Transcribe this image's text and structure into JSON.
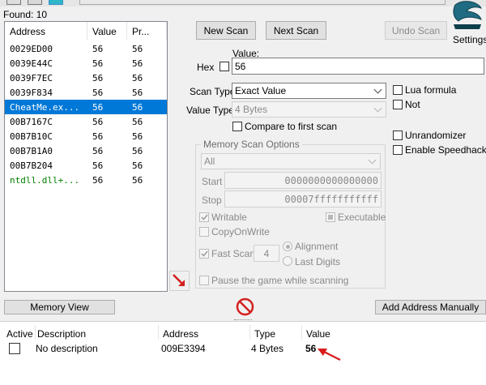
{
  "found_label": "Found: 10",
  "results": {
    "columns": [
      "Address",
      "Value",
      "Pr..."
    ],
    "rows": [
      {
        "address": "0029ED00",
        "value": "56",
        "previous": "56"
      },
      {
        "address": "0039E44C",
        "value": "56",
        "previous": "56"
      },
      {
        "address": "0039F7EC",
        "value": "56",
        "previous": "56"
      },
      {
        "address": "0039F834",
        "value": "56",
        "previous": "56"
      },
      {
        "address": "CheatMe.ex...",
        "value": "56",
        "previous": "56"
      },
      {
        "address": "00B7167C",
        "value": "56",
        "previous": "56"
      },
      {
        "address": "00B7B10C",
        "value": "56",
        "previous": "56"
      },
      {
        "address": "00B7B1A0",
        "value": "56",
        "previous": "56"
      },
      {
        "address": "00B7B204",
        "value": "56",
        "previous": "56"
      },
      {
        "address": "ntdll.dll+...",
        "value": "56",
        "previous": "56"
      }
    ]
  },
  "scan": {
    "new_scan": "New Scan",
    "next_scan": "Next Scan",
    "undo_scan": "Undo Scan",
    "settings": "Settings",
    "value_label": "Value:",
    "hex_label": "Hex",
    "value": "56",
    "scan_type_label": "Scan Type",
    "scan_type": "Exact Value",
    "value_type_label": "Value Type",
    "value_type": "4 Bytes",
    "compare_first": "Compare to first scan",
    "lua_formula": "Lua formula",
    "not_label": "Not",
    "unrandomizer": "Unrandomizer",
    "enable_speedhack": "Enable Speedhack"
  },
  "memory_options": {
    "title": "Memory Scan Options",
    "region": "All",
    "start_label": "Start",
    "start": "0000000000000000",
    "stop_label": "Stop",
    "stop": "00007fffffffffff",
    "writable": "Writable",
    "executable": "Executable",
    "copy_on_write": "CopyOnWrite",
    "fast_scan": "Fast Scan",
    "fast_scan_value": "4",
    "alignment": "Alignment",
    "last_digits": "Last Digits",
    "pause_game": "Pause the game while scanning"
  },
  "bottom": {
    "memory_view": "Memory View",
    "add_address": "Add Address Manually"
  },
  "address_list": {
    "columns": [
      "Active",
      "Description",
      "Address",
      "Type",
      "Value"
    ],
    "rows": [
      {
        "description": "No description",
        "address": "009E3394",
        "type": "4 Bytes",
        "value": "56"
      }
    ]
  },
  "colors": {
    "selection": "#0078d7",
    "module_text": "#008000",
    "annotation_arrow": "#d81b1b",
    "no_sign": "#d32020"
  },
  "icons": [
    "open-process-icon",
    "save-icon",
    "settings-logo-icon",
    "add-to-list-arrow-icon",
    "clear-list-icon",
    "annotation-arrow-icon"
  ]
}
